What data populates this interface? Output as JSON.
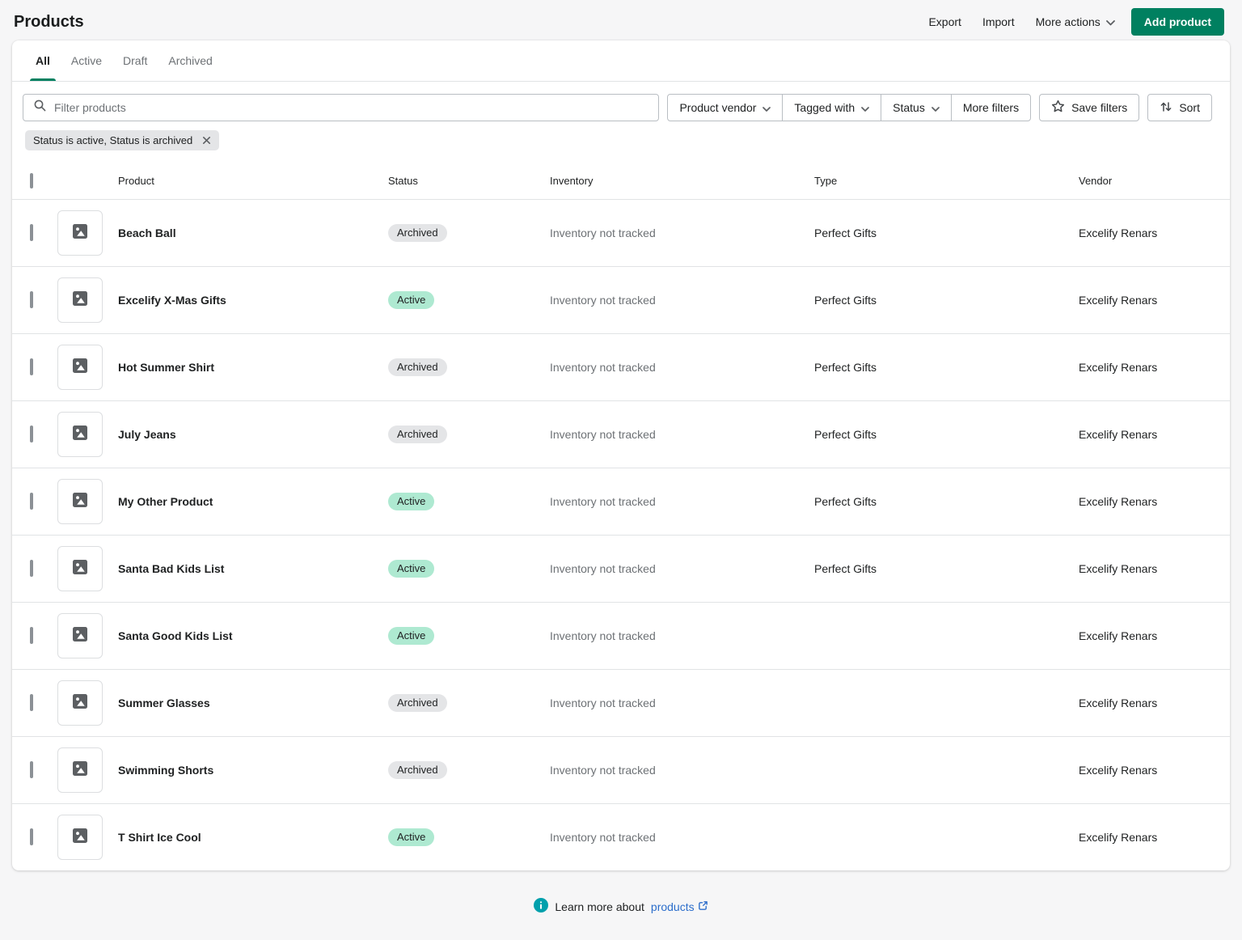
{
  "header": {
    "title": "Products",
    "actions": {
      "export": "Export",
      "import": "Import",
      "more_actions": "More actions",
      "add_product": "Add product"
    }
  },
  "tabs": {
    "items": [
      {
        "label": "All",
        "active": true
      },
      {
        "label": "Active",
        "active": false
      },
      {
        "label": "Draft",
        "active": false
      },
      {
        "label": "Archived",
        "active": false
      }
    ]
  },
  "filters": {
    "search_placeholder": "Filter products",
    "product_vendor": "Product vendor",
    "tagged_with": "Tagged with",
    "status": "Status",
    "more_filters": "More filters",
    "save_filters": "Save filters",
    "sort": "Sort",
    "applied_filter_chip": "Status is active, Status is archived"
  },
  "table": {
    "columns": {
      "product": "Product",
      "status": "Status",
      "inventory": "Inventory",
      "type": "Type",
      "vendor": "Vendor"
    },
    "rows": [
      {
        "name": "Beach Ball",
        "status": "Archived",
        "inventory": "Inventory not tracked",
        "type": "Perfect Gifts",
        "vendor": "Excelify Renars"
      },
      {
        "name": "Excelify X-Mas Gifts",
        "status": "Active",
        "inventory": "Inventory not tracked",
        "type": "Perfect Gifts",
        "vendor": "Excelify Renars"
      },
      {
        "name": "Hot Summer Shirt",
        "status": "Archived",
        "inventory": "Inventory not tracked",
        "type": "Perfect Gifts",
        "vendor": "Excelify Renars"
      },
      {
        "name": "July Jeans",
        "status": "Archived",
        "inventory": "Inventory not tracked",
        "type": "Perfect Gifts",
        "vendor": "Excelify Renars"
      },
      {
        "name": "My Other Product",
        "status": "Active",
        "inventory": "Inventory not tracked",
        "type": "Perfect Gifts",
        "vendor": "Excelify Renars"
      },
      {
        "name": "Santa Bad Kids List",
        "status": "Active",
        "inventory": "Inventory not tracked",
        "type": "Perfect Gifts",
        "vendor": "Excelify Renars"
      },
      {
        "name": "Santa Good Kids List",
        "status": "Active",
        "inventory": "Inventory not tracked",
        "type": "",
        "vendor": "Excelify Renars"
      },
      {
        "name": "Summer Glasses",
        "status": "Archived",
        "inventory": "Inventory not tracked",
        "type": "",
        "vendor": "Excelify Renars"
      },
      {
        "name": "Swimming Shorts",
        "status": "Archived",
        "inventory": "Inventory not tracked",
        "type": "",
        "vendor": "Excelify Renars"
      },
      {
        "name": "T Shirt Ice Cool",
        "status": "Active",
        "inventory": "Inventory not tracked",
        "type": "",
        "vendor": "Excelify Renars"
      }
    ]
  },
  "footer": {
    "learn_more_text": "Learn more about",
    "link_label": "products"
  },
  "colors": {
    "primary_green": "#008060",
    "badge_success_bg": "#aee9d1",
    "badge_default_bg": "#e4e5e7",
    "link_blue": "#2c6ecb",
    "info_icon_teal": "#00a0ac",
    "page_background": "#f6f6f7"
  }
}
